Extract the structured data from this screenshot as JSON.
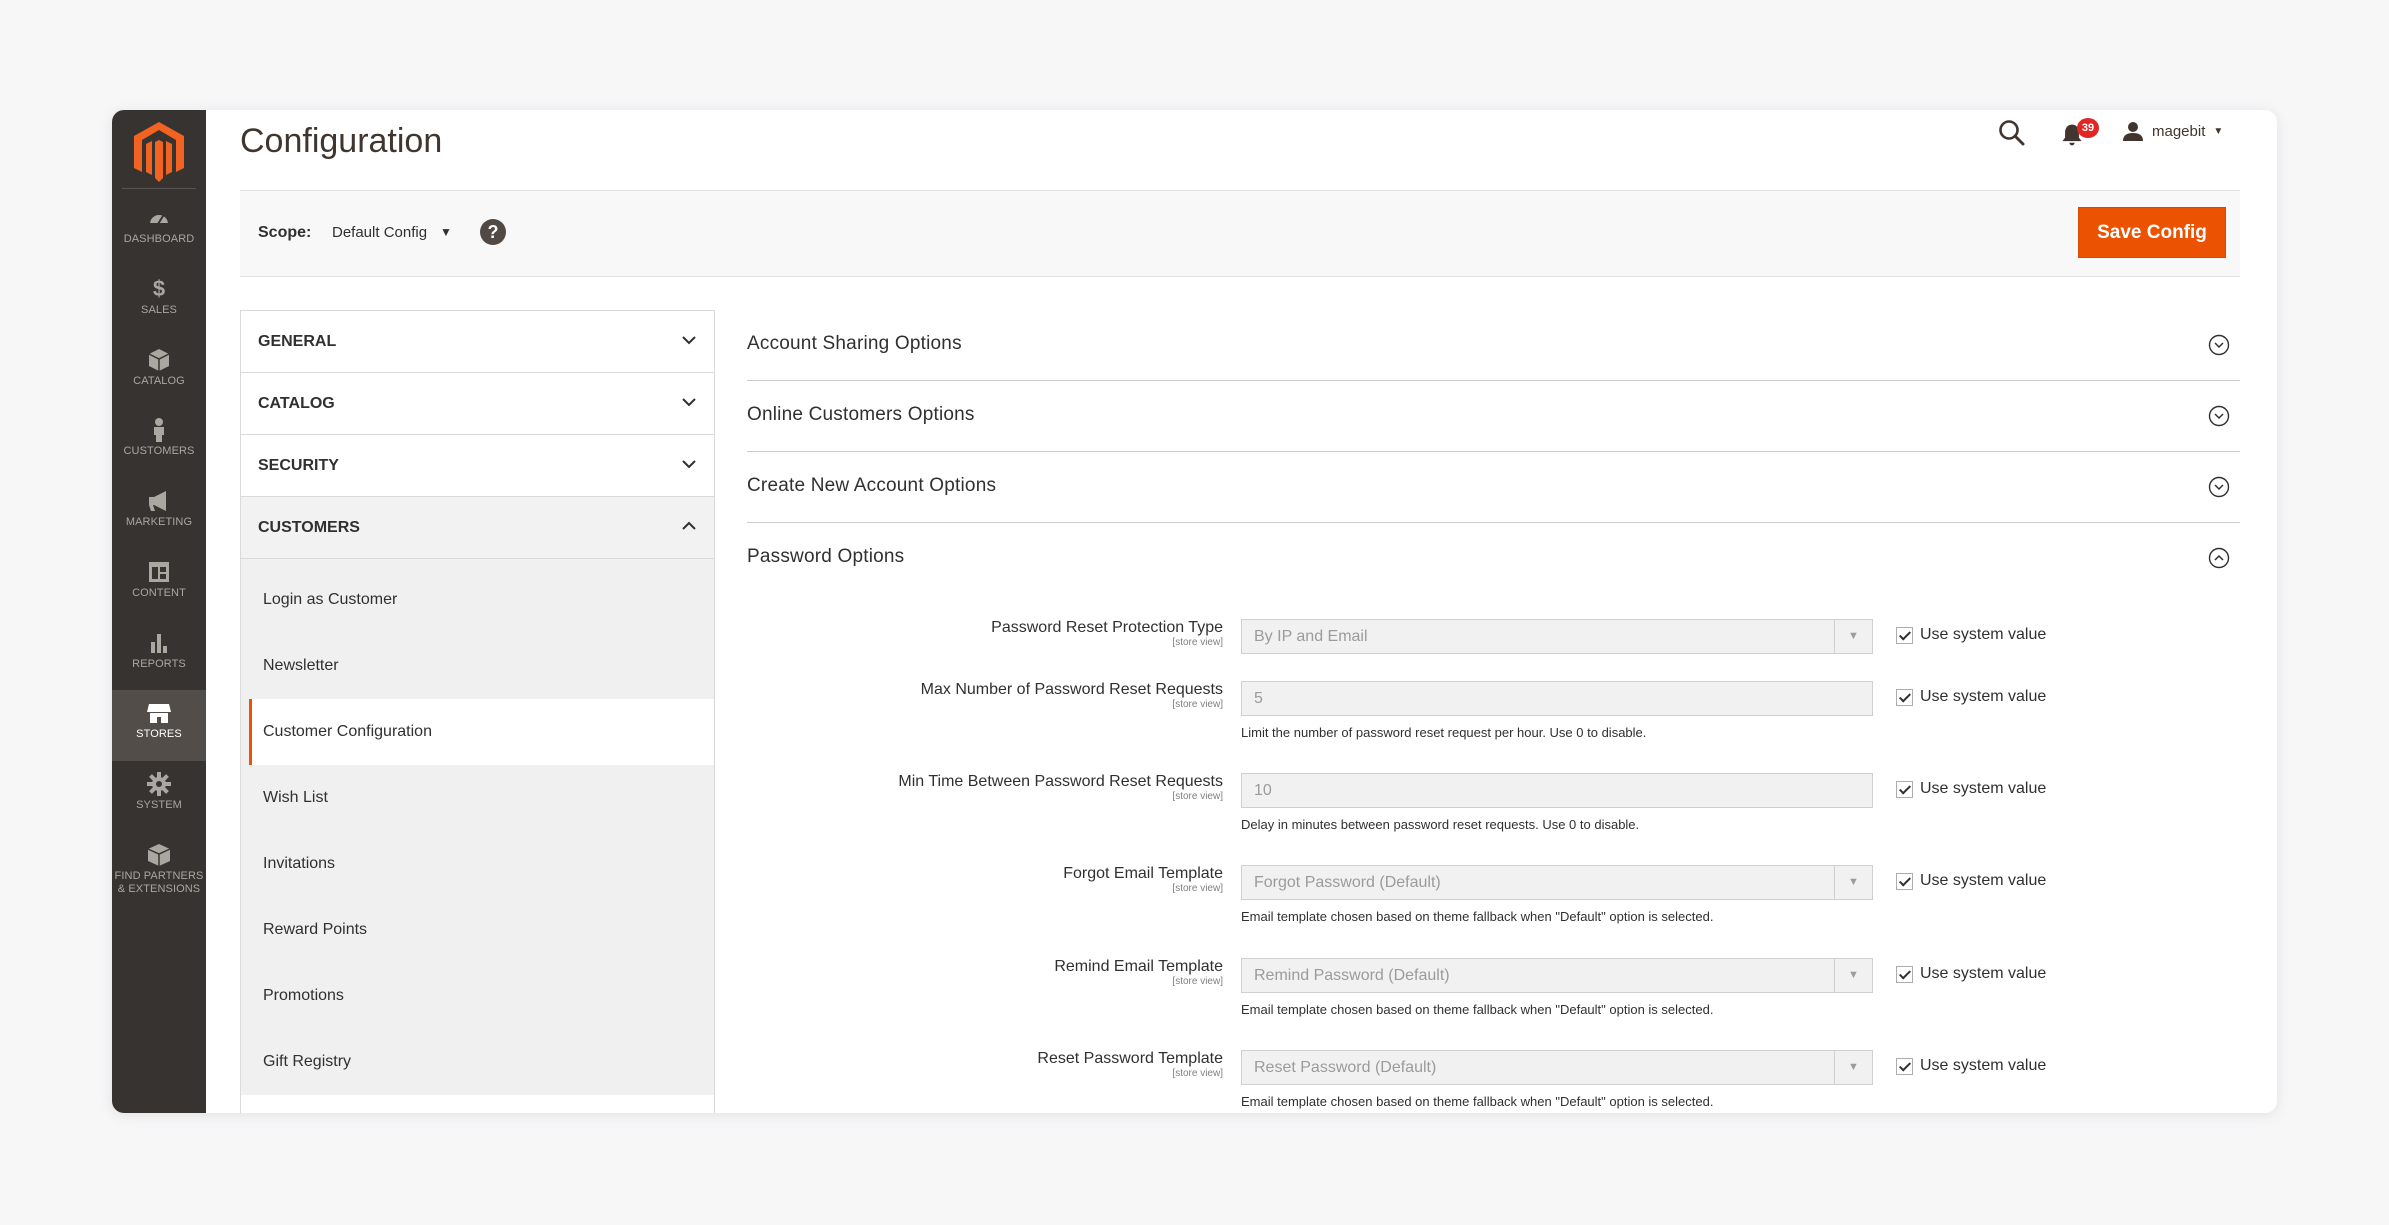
{
  "header": {
    "title": "Configuration",
    "notification_count": "39",
    "username": "magebit"
  },
  "sidebar": {
    "items": [
      {
        "label": "DASHBOARD",
        "icon": "dashboard-icon"
      },
      {
        "label": "SALES",
        "icon": "dollar-icon"
      },
      {
        "label": "CATALOG",
        "icon": "cube-icon"
      },
      {
        "label": "CUSTOMERS",
        "icon": "person-icon"
      },
      {
        "label": "MARKETING",
        "icon": "megaphone-icon"
      },
      {
        "label": "CONTENT",
        "icon": "layout-icon"
      },
      {
        "label": "REPORTS",
        "icon": "bar-chart-icon"
      },
      {
        "label": "STORES",
        "icon": "store-icon"
      },
      {
        "label": "SYSTEM",
        "icon": "gear-icon"
      },
      {
        "label": "FIND PARTNERS & EXTENSIONS",
        "icon": "box-icon"
      }
    ],
    "active": "STORES"
  },
  "scope": {
    "label": "Scope:",
    "value": "Default Config",
    "help": "?"
  },
  "save_label": "Save Config",
  "tabs": [
    {
      "label": "GENERAL",
      "open": false
    },
    {
      "label": "CATALOG",
      "open": false
    },
    {
      "label": "SECURITY",
      "open": false
    },
    {
      "label": "CUSTOMERS",
      "open": true
    }
  ],
  "customer_subitems": [
    "Login as Customer",
    "Newsletter",
    "Customer Configuration",
    "Wish List",
    "Invitations",
    "Reward Points",
    "Promotions",
    "Gift Registry"
  ],
  "active_subitem": "Customer Configuration",
  "sections": [
    {
      "title": "Account Sharing Options",
      "open": false
    },
    {
      "title": "Online Customers Options",
      "open": false
    },
    {
      "title": "Create New Account Options",
      "open": false
    },
    {
      "title": "Password Options",
      "open": true
    }
  ],
  "password_fields": [
    {
      "label": "Password Reset Protection Type",
      "scope": "[store view]",
      "value": "By IP and Email",
      "type": "select",
      "note": "",
      "use_system": "Use system value"
    },
    {
      "label": "Max Number of Password Reset Requests",
      "scope": "[store view]",
      "value": "5",
      "type": "text",
      "note": "Limit the number of password reset request per hour. Use 0 to disable.",
      "use_system": "Use system value"
    },
    {
      "label": "Min Time Between Password Reset Requests",
      "scope": "[store view]",
      "value": "10",
      "type": "text",
      "note": "Delay in minutes between password reset requests. Use 0 to disable.",
      "use_system": "Use system value"
    },
    {
      "label": "Forgot Email Template",
      "scope": "[store view]",
      "value": "Forgot Password (Default)",
      "type": "select",
      "note": "Email template chosen based on theme fallback when \"Default\" option is selected.",
      "use_system": "Use system value"
    },
    {
      "label": "Remind Email Template",
      "scope": "[store view]",
      "value": "Remind Password (Default)",
      "type": "select",
      "note": "Email template chosen based on theme fallback when \"Default\" option is selected.",
      "use_system": "Use system value"
    },
    {
      "label": "Reset Password Template",
      "scope": "[store view]",
      "value": "Reset Password (Default)",
      "type": "select",
      "note": "Email template chosen based on theme fallback when \"Default\" option is selected.",
      "use_system": "Use system value"
    }
  ],
  "colors": {
    "accent": "#eb5202",
    "sidebar": "#373330",
    "sidebar_active": "#524d49",
    "badge": "#e22626"
  }
}
